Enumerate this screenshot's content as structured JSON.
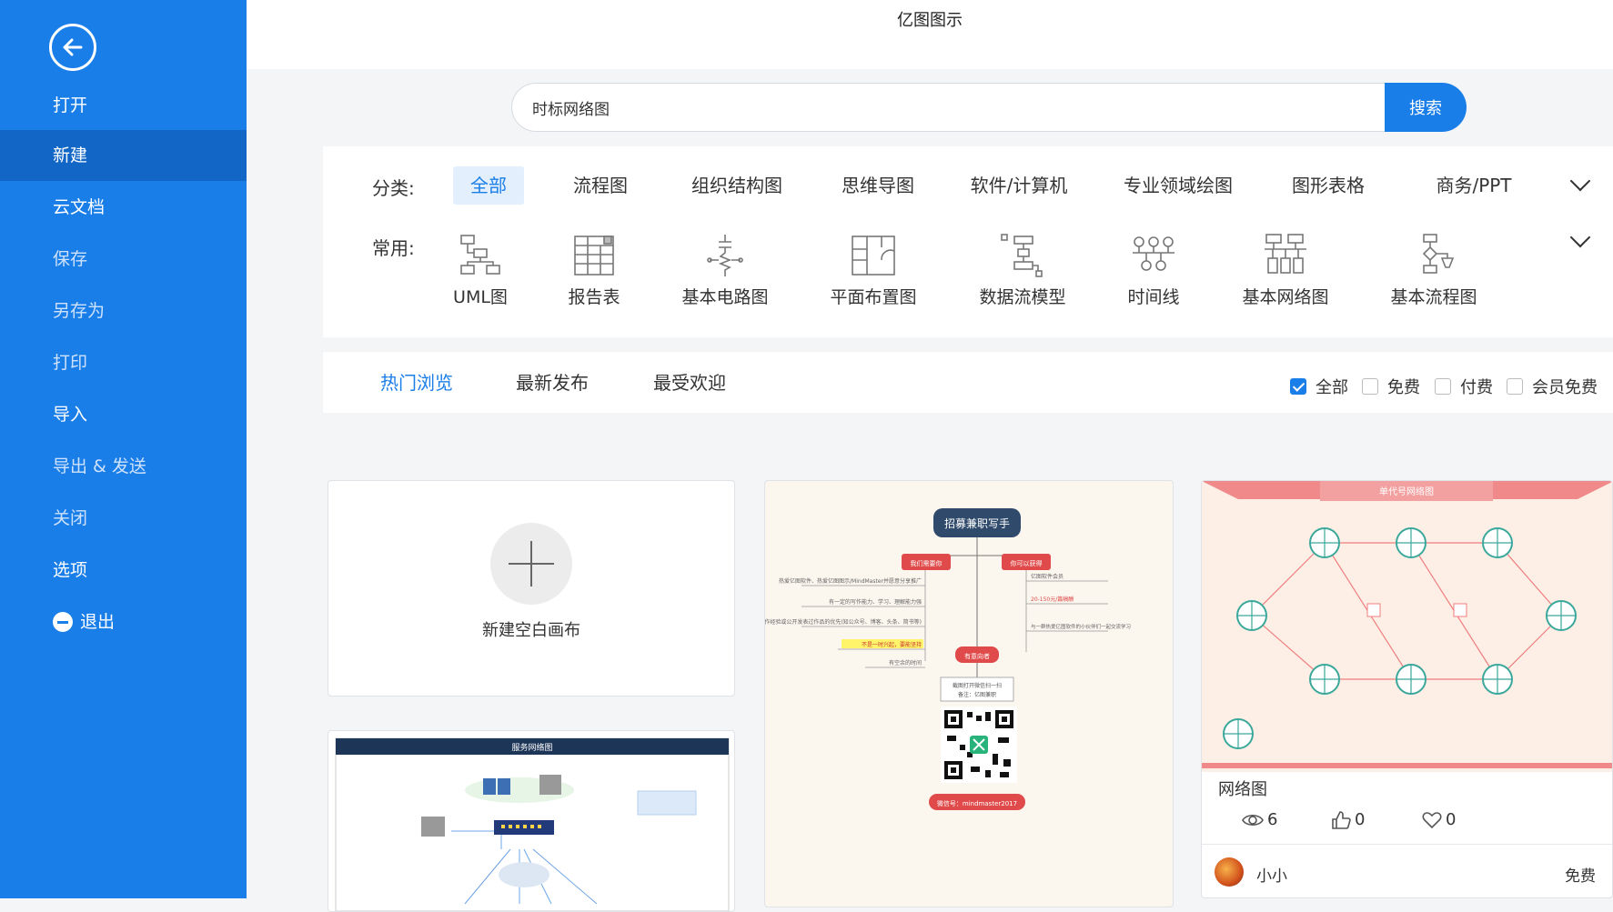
{
  "app": {
    "title": "亿图图示"
  },
  "sidebar": {
    "items": [
      {
        "label": "打开"
      },
      {
        "label": "新建"
      },
      {
        "label": "云文档"
      },
      {
        "label": "保存"
      },
      {
        "label": "另存为"
      },
      {
        "label": "打印"
      },
      {
        "label": "导入"
      },
      {
        "label": "导出 & 发送"
      },
      {
        "label": "关闭"
      },
      {
        "label": "选项"
      },
      {
        "label": "退出"
      }
    ]
  },
  "search": {
    "value": "时标网络图",
    "button": "搜索"
  },
  "categories": {
    "label": "分类:",
    "items": [
      "全部",
      "流程图",
      "组织结构图",
      "思维导图",
      "软件/计算机",
      "专业领域绘图",
      "图形表格",
      "商务/PPT"
    ]
  },
  "common": {
    "label": "常用:",
    "items": [
      "UML图",
      "报告表",
      "基本电路图",
      "平面布置图",
      "数据流模型",
      "时间线",
      "基本网络图",
      "基本流程图"
    ]
  },
  "tabs": [
    "热门浏览",
    "最新发布",
    "最受欢迎"
  ],
  "filters": [
    {
      "label": "全部",
      "checked": true
    },
    {
      "label": "免费",
      "checked": false
    },
    {
      "label": "付费",
      "checked": false
    },
    {
      "label": "会员免费",
      "checked": false
    }
  ],
  "cards": {
    "new_canvas": "新建空白画布",
    "mindmap": {
      "title": "招募兼职写手",
      "branch_left": "我们需要你",
      "branch_right": "你可以获得",
      "branch_bottom": "有意向者",
      "left_items": [
        "热爱亿图软件、热爱亿图图示/MindMaster并愿意分享推广",
        "有一定的写作能力、学习、理解能力强",
        "有写作经验或公开发表过作品的优先(知公众号、博客、头条、简书等)",
        "不是一时兴起，要能坚持",
        "有空余的时间"
      ],
      "right_items": [
        "亿图软件会员",
        "20-150元/篇稿酬",
        "与一群热爱亿图软件的小伙伴们一起交流学习"
      ],
      "bottom_items": [
        "截图打开微信扫一扫",
        "备注：亿图兼职"
      ],
      "wechat": "微信号：mindmaster2017"
    },
    "network": {
      "banner": "单代号网络图",
      "title": "网络图",
      "views": "6",
      "likes": "0",
      "favorites": "0",
      "author": "小小",
      "price": "免费"
    },
    "topology": {
      "banner": "服务网络图"
    }
  }
}
